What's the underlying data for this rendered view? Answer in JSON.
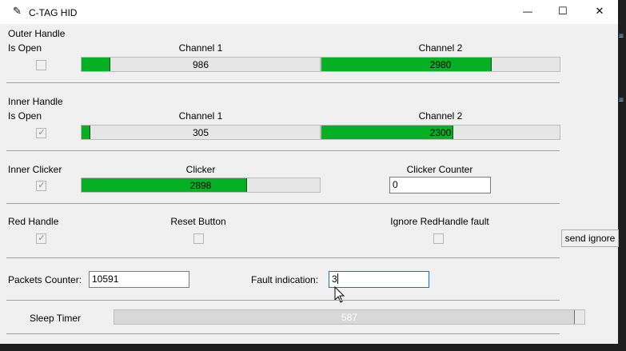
{
  "window": {
    "title": "C-TAG HID",
    "controls": {
      "minimize": "—",
      "maximize": "☐",
      "close": "✕"
    }
  },
  "outer_handle": {
    "section_label": "Outer Handle",
    "is_open_label": "Is Open",
    "is_open_checked": false,
    "channel1": {
      "label": "Channel 1",
      "value": "986",
      "fill_fraction": 0.118
    },
    "channel2": {
      "label": "Channel 2",
      "value": "2980",
      "fill_fraction": 0.71
    }
  },
  "inner_handle": {
    "section_label": "Inner Handle",
    "is_open_label": "Is Open",
    "is_open_checked": true,
    "checkmark": "✓",
    "channel1": {
      "label": "Channel 1",
      "value": "305",
      "fill_fraction": 0.033
    },
    "channel2": {
      "label": "Channel 2",
      "value": "2300",
      "fill_fraction": 0.55
    }
  },
  "inner_clicker": {
    "section_label": "Inner Clicker",
    "checked": true,
    "checkmark": "✓",
    "clicker": {
      "label": "Clicker",
      "value": "2898",
      "fill_fraction": 0.69
    },
    "counter_label": "Clicker Counter",
    "counter_value": "0"
  },
  "red_handle": {
    "label": "Red Handle",
    "checked": true,
    "checkmark": "✓",
    "reset_label": "Reset Button",
    "reset_checked": false,
    "ignore_label": "Ignore RedHandle fault",
    "ignore_checked": false
  },
  "send_ignore_label": "send ignore",
  "packets": {
    "label": "Packets Counter:",
    "value": "10591"
  },
  "fault": {
    "label": "Fault indication:",
    "value": "3"
  },
  "sleep_timer": {
    "label": "Sleep Timer",
    "value": "587",
    "fill_fraction": 0.978
  },
  "colors": {
    "progress_fill": "#06b025"
  }
}
